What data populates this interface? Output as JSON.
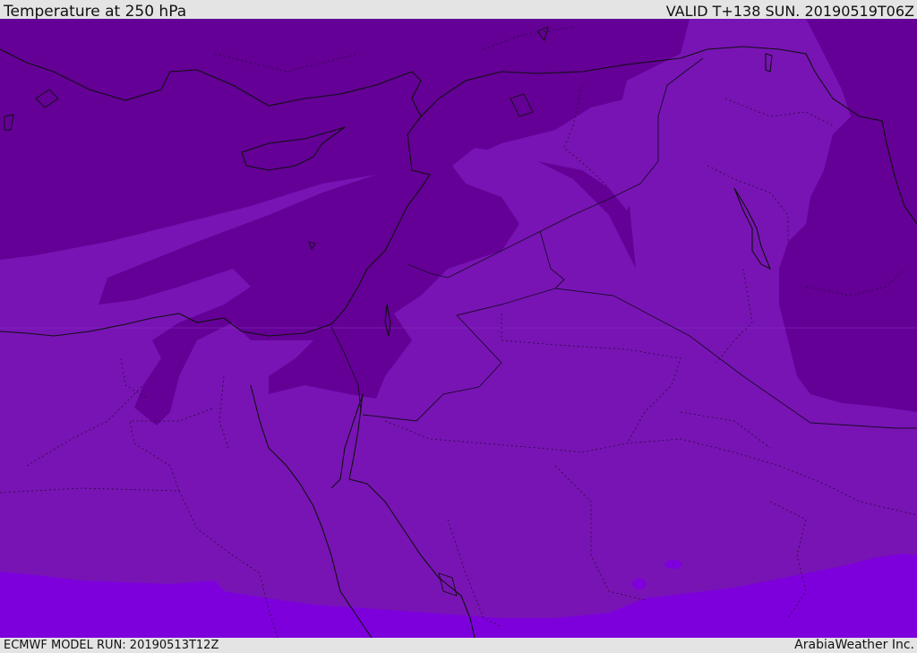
{
  "header": {
    "title": "Temperature at 250 hPa",
    "valid": "VALID T+138 SUN. 20190519T06Z"
  },
  "footer": {
    "model_run": "ECMWF MODEL RUN: 20190513T12Z",
    "credit": "ArabiaWeather Inc."
  },
  "map": {
    "colors": {
      "band_dark": "#640096",
      "band_mid": "#7814b4",
      "band_light": "#7d00dc",
      "coast": "#101010",
      "border": "#1a0a2a"
    }
  }
}
